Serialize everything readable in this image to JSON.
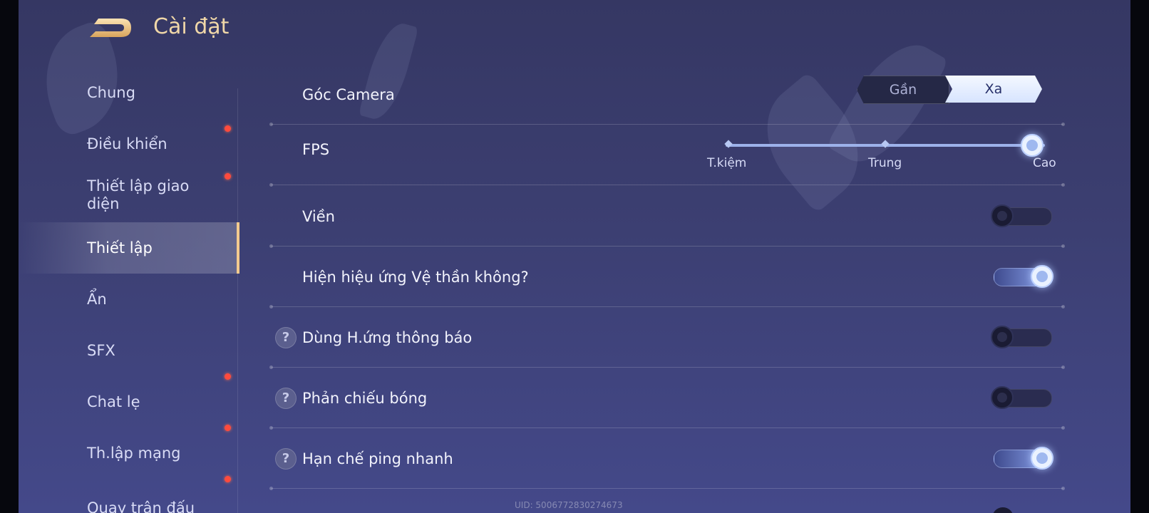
{
  "header": {
    "title": "Cài đặt"
  },
  "sidebar": {
    "items": [
      {
        "label": "Chung",
        "active": false,
        "dot": false
      },
      {
        "label": "Điều khiển",
        "active": false,
        "dot": true
      },
      {
        "label": "Thiết lập giao diện",
        "active": false,
        "dot": true
      },
      {
        "label": "Thiết lập",
        "active": true,
        "dot": false
      },
      {
        "label": "Ẩn",
        "active": false,
        "dot": false
      },
      {
        "label": "SFX",
        "active": false,
        "dot": false
      },
      {
        "label": "Chat lẹ",
        "active": false,
        "dot": true
      },
      {
        "label": "Th.lập mạng",
        "active": false,
        "dot": true
      },
      {
        "label": "Quay trận đấu",
        "active": false,
        "dot": true
      }
    ]
  },
  "settings": {
    "camera": {
      "label": "Góc Camera",
      "options": [
        "Gần",
        "Xa"
      ],
      "selected": "Xa"
    },
    "fps": {
      "label": "FPS",
      "levels": [
        "T.kiệm",
        "Trung",
        "Cao"
      ],
      "selected": "Cao"
    },
    "outline": {
      "label": "Viền",
      "on": false
    },
    "guardian_effect": {
      "label": "Hiện hiệu ứng Vệ thần không?",
      "on": true
    },
    "notify_effect": {
      "label": "Dùng H.ứng thông báo",
      "on": false,
      "help": "?"
    },
    "shadow": {
      "label": "Phản chiếu bóng",
      "on": false,
      "help": "?"
    },
    "ping_limit": {
      "label": "Hạn chế ping nhanh",
      "on": true,
      "help": "?"
    }
  },
  "footer": {
    "uid": "UID: 5006772830274673"
  },
  "colors": {
    "title": "#f0d7a8",
    "active_bar": "#f2c88a",
    "notify_dot": "#ff4a3d",
    "accent": "#9db2ea"
  }
}
